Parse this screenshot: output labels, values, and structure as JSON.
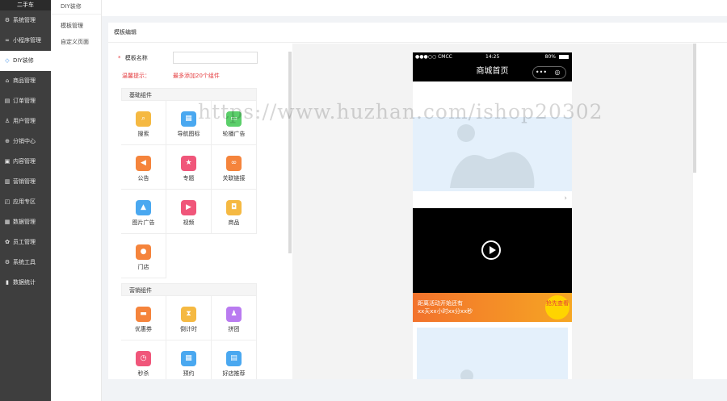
{
  "sidebar": {
    "brand": "二手车",
    "items": [
      {
        "label": "系统管理",
        "icon": "gear-icon"
      },
      {
        "label": "小程序管理",
        "icon": "link-icon"
      },
      {
        "label": "DIY装修",
        "icon": "diamond-icon",
        "active": true
      },
      {
        "label": "商品管理",
        "icon": "home-icon"
      },
      {
        "label": "订单管理",
        "icon": "document-icon"
      },
      {
        "label": "用户管理",
        "icon": "user-icon"
      },
      {
        "label": "分销中心",
        "icon": "share-icon"
      },
      {
        "label": "内容管理",
        "icon": "content-icon"
      },
      {
        "label": "营销管理",
        "icon": "marketing-icon"
      },
      {
        "label": "应用专区",
        "icon": "app-icon"
      },
      {
        "label": "数据管理",
        "icon": "data-icon"
      },
      {
        "label": "员工管理",
        "icon": "staff-icon"
      },
      {
        "label": "系统工具",
        "icon": "tools-icon"
      },
      {
        "label": "数据统计",
        "icon": "chart-icon"
      }
    ]
  },
  "submenu": {
    "title": "DIY装修",
    "items": [
      "模板管理",
      "自定义页面"
    ]
  },
  "main": {
    "head": "模板编辑",
    "form": {
      "name_label": "模板名称",
      "required_mark": "*",
      "tip_label": "温馨提示：",
      "tip_text": "最多添加20个组件"
    },
    "basic_group": {
      "title": "基础组件",
      "items": [
        {
          "label": "搜索",
          "icon": "search-icon",
          "color": "#f5b942"
        },
        {
          "label": "导航图标",
          "icon": "nav-icon",
          "color": "#4aa8f0"
        },
        {
          "label": "轮播广告",
          "icon": "carousel-icon",
          "color": "#5bcf6a"
        },
        {
          "label": "公告",
          "icon": "announce-icon",
          "color": "#f5843c"
        },
        {
          "label": "专题",
          "icon": "topic-icon",
          "color": "#f0567a"
        },
        {
          "label": "关联链接",
          "icon": "link-icon",
          "color": "#f5843c"
        },
        {
          "label": "图片广告",
          "icon": "image-icon",
          "color": "#4aa8f0"
        },
        {
          "label": "视频",
          "icon": "video-icon",
          "color": "#f0567a"
        },
        {
          "label": "商品",
          "icon": "goods-icon",
          "color": "#f5b942"
        },
        {
          "label": "门店",
          "icon": "store-icon",
          "color": "#f5843c"
        }
      ]
    },
    "marketing_group": {
      "title": "营销组件",
      "items": [
        {
          "label": "优惠券",
          "icon": "coupon-icon",
          "color": "#f5843c"
        },
        {
          "label": "倒计时",
          "icon": "hourglass-icon",
          "color": "#f5b942"
        },
        {
          "label": "拼团",
          "icon": "group-icon",
          "color": "#b97bf0"
        },
        {
          "label": "秒杀",
          "icon": "clock-icon",
          "color": "#f0567a"
        },
        {
          "label": "预约",
          "icon": "calendar-icon",
          "color": "#4aa8f0"
        },
        {
          "label": "好店推荐",
          "icon": "shop-icon",
          "color": "#4aa8f0"
        }
      ]
    }
  },
  "phone": {
    "carrier": "●●●○○ CMCC",
    "time": "14:25",
    "battery": "80%",
    "title": "商城首页",
    "capsule_more": "•••",
    "capsule_close": "◎",
    "promo_line1": "距离活动开始还有",
    "promo_line2": "xx天xx小时xx分xx秒",
    "promo_badge": "抢先查看"
  },
  "watermark": "https://www.huzhan.com/ishop20302"
}
